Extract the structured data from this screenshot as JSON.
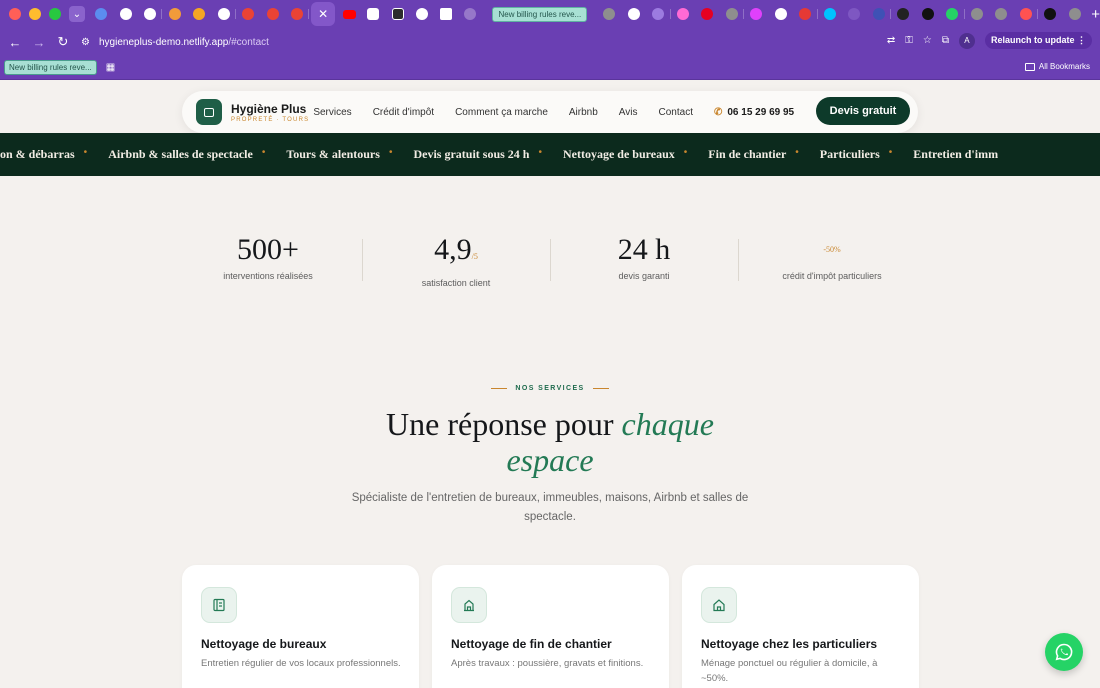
{
  "browser": {
    "active_tab_title": "New billing rules reve...",
    "url_domain": "hygieneplus-demo.netlify.app",
    "url_path": "/#contact",
    "profile_initial": "A",
    "relaunch_label": "Relaunch to update",
    "bookmark_chip": "New billing rules reve...",
    "all_bookmarks_label": "All Bookmarks",
    "colors": {
      "frame": "#6a3fb3",
      "tab_group": "#a8e0d4"
    }
  },
  "nav": {
    "brand_name": "Hygiène Plus",
    "brand_tag": "PROPRETÉ · TOURS",
    "menu": [
      "Services",
      "Crédit d'impôt",
      "Comment ça marche",
      "Airbnb",
      "Avis",
      "Contact"
    ],
    "phone": "06 15 29 69 95",
    "cta_label": "Devis gratuit"
  },
  "marquee": [
    "aison & débarras",
    "Airbnb & salles de spectacle",
    "Tours & alentours",
    "Devis gratuit sous 24 h",
    "Nettoyage de bureaux",
    "Fin de chantier",
    "Particuliers",
    "Entretien d'imm"
  ],
  "stats": [
    {
      "value": "500+",
      "suffix": "",
      "label": "interventions réalisées"
    },
    {
      "value": "4,9",
      "suffix": "/5",
      "label": "satisfaction client"
    },
    {
      "value": "24 h",
      "suffix": "",
      "label": "devis garanti"
    },
    {
      "value": "-50%",
      "suffix": "",
      "label": "crédit d'impôt particuliers"
    }
  ],
  "services": {
    "eyebrow": "NOS SERVICES",
    "heading_plain": "Une réponse pour",
    "heading_accent_1": "chaque",
    "heading_accent_2": "espace",
    "subtitle": "Spécialiste de l'entretien de bureaux, immeubles, maisons, Airbnb et salles de spectacle.",
    "cards": [
      {
        "icon": "office-icon",
        "title": "Nettoyage de bureaux",
        "desc": "Entretien régulier de vos locaux professionnels."
      },
      {
        "icon": "construction-icon",
        "title": "Nettoyage de fin de chantier",
        "desc": "Après travaux : poussière, gravats et finitions."
      },
      {
        "icon": "home-icon",
        "title": "Nettoyage chez les particuliers",
        "desc": "Ménage ponctuel ou régulier à domicile, à ~50%."
      }
    ]
  },
  "colors": {
    "brand_green": "#0d3a2a",
    "accent_green": "#237a55",
    "gold": "#c9862e",
    "whatsapp": "#25d366"
  }
}
